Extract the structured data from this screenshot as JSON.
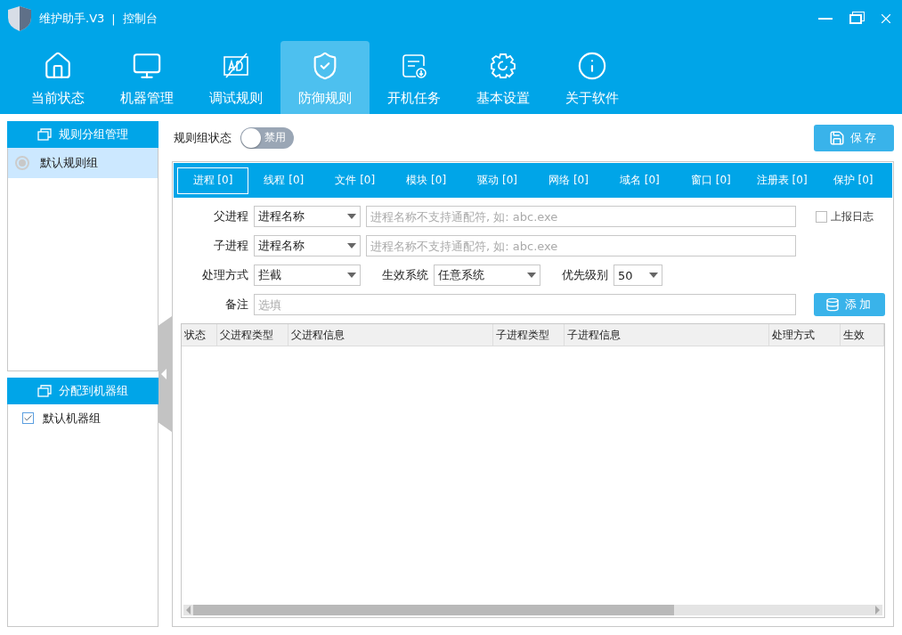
{
  "window": {
    "title": "维护助手.V3",
    "separator": "|",
    "subtitle": "控制台"
  },
  "nav": [
    {
      "label": "当前状态",
      "kind": "home",
      "selected": false
    },
    {
      "label": "机器管理",
      "kind": "monitor",
      "selected": false
    },
    {
      "label": "调试规则",
      "kind": "ad",
      "selected": false
    },
    {
      "label": "防御规则",
      "kind": "shield",
      "selected": true
    },
    {
      "label": "开机任务",
      "kind": "task",
      "selected": false
    },
    {
      "label": "基本设置",
      "kind": "gear",
      "selected": false
    },
    {
      "label": "关于软件",
      "kind": "info",
      "selected": false
    }
  ],
  "sidebar": {
    "rule_groups": {
      "title": "规则分组管理",
      "items": [
        {
          "label": "默认规则组",
          "selected": true
        }
      ]
    },
    "machine_groups": {
      "title": "分配到机器组",
      "items": [
        {
          "label": "默认机器组",
          "checked": true
        }
      ]
    }
  },
  "rule_status": {
    "label": "规则组状态",
    "on": false,
    "text": "禁用"
  },
  "save_button": "保存",
  "tabs": [
    {
      "label": "进程 [0]",
      "selected": true
    },
    {
      "label": "线程 [0]",
      "selected": false
    },
    {
      "label": "文件 [0]",
      "selected": false
    },
    {
      "label": "模块 [0]",
      "selected": false
    },
    {
      "label": "驱动 [0]",
      "selected": false
    },
    {
      "label": "网络 [0]",
      "selected": false
    },
    {
      "label": "域名 [0]",
      "selected": false
    },
    {
      "label": "窗口 [0]",
      "selected": false
    },
    {
      "label": "注册表 [0]",
      "selected": false
    },
    {
      "label": "保护 [0]",
      "selected": false
    }
  ],
  "form": {
    "parent": {
      "label": "父进程",
      "type": "进程名称",
      "placeholder": "进程名称不支持通配符, 如: abc.exe"
    },
    "child": {
      "label": "子进程",
      "type": "进程名称",
      "placeholder": "进程名称不支持通配符, 如: abc.exe"
    },
    "report_log": {
      "label": "上报日志",
      "checked": false
    },
    "action": {
      "label": "处理方式",
      "value": "拦截"
    },
    "system": {
      "label": "生效系统",
      "value": "任意系统"
    },
    "priority": {
      "label": "优先级别",
      "value": "50"
    },
    "note": {
      "label": "备注",
      "placeholder": "选填"
    },
    "add_button": "添加"
  },
  "table": {
    "columns": [
      "状态",
      "父进程类型",
      "父进程信息",
      "子进程类型",
      "子进程信息",
      "处理方式",
      "生效"
    ]
  }
}
